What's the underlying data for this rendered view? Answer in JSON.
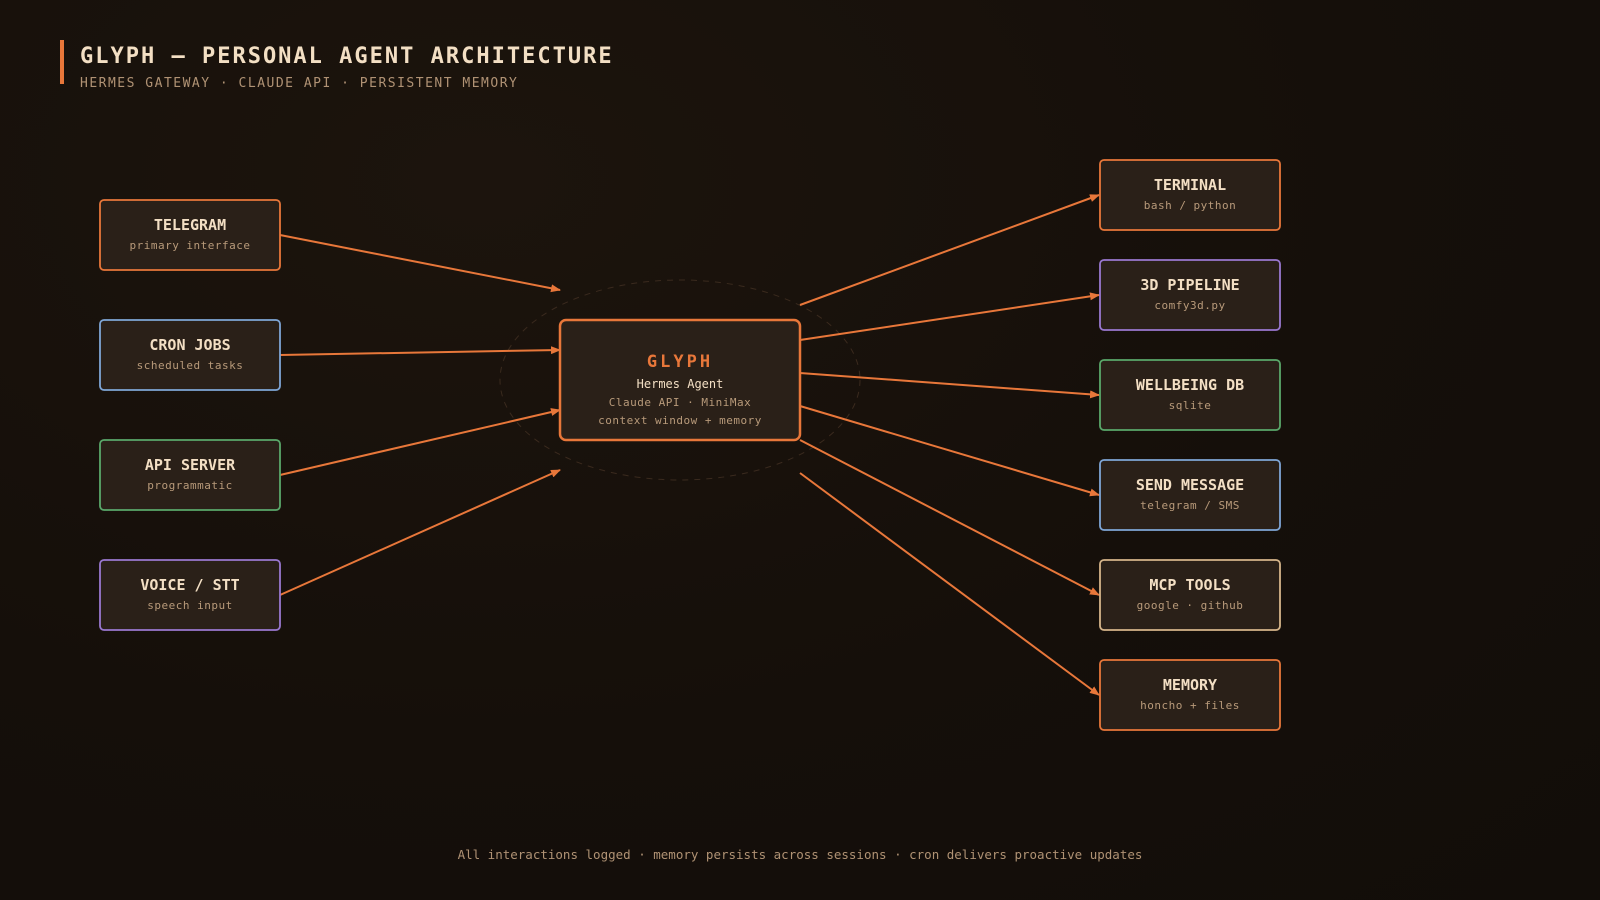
{
  "header": {
    "title": "GLYPH — PERSONAL AGENT ARCHITECTURE",
    "subtitle": "HERMES GATEWAY · CLAUDE API · PERSISTENT MEMORY"
  },
  "colors": {
    "accent": "#e8773a",
    "blue": "#7fa6d6",
    "green": "#5aa86a",
    "purple": "#9a78d0",
    "tan": "#d6b58a",
    "node_fill": "#2a2018"
  },
  "hub": {
    "title": "GLYPH",
    "name": "Hermes Agent",
    "line1": "Claude API · MiniMax",
    "line2": "context window + memory"
  },
  "inputs": [
    {
      "title": "TELEGRAM",
      "sub": "primary interface",
      "color": "accent"
    },
    {
      "title": "CRON JOBS",
      "sub": "scheduled tasks",
      "color": "blue"
    },
    {
      "title": "API SERVER",
      "sub": "programmatic",
      "color": "green"
    },
    {
      "title": "VOICE / STT",
      "sub": "speech input",
      "color": "purple"
    }
  ],
  "outputs": [
    {
      "title": "TERMINAL",
      "sub": "bash / python",
      "color": "accent"
    },
    {
      "title": "3D PIPELINE",
      "sub": "comfy3d.py",
      "color": "purple"
    },
    {
      "title": "WELLBEING DB",
      "sub": "sqlite",
      "color": "green"
    },
    {
      "title": "SEND MESSAGE",
      "sub": "telegram / SMS",
      "color": "blue"
    },
    {
      "title": "MCP TOOLS",
      "sub": "google · github",
      "color": "tan"
    },
    {
      "title": "MEMORY",
      "sub": "honcho + files",
      "color": "accent"
    }
  ],
  "footer": "All interactions logged · memory persists across sessions · cron delivers proactive updates"
}
